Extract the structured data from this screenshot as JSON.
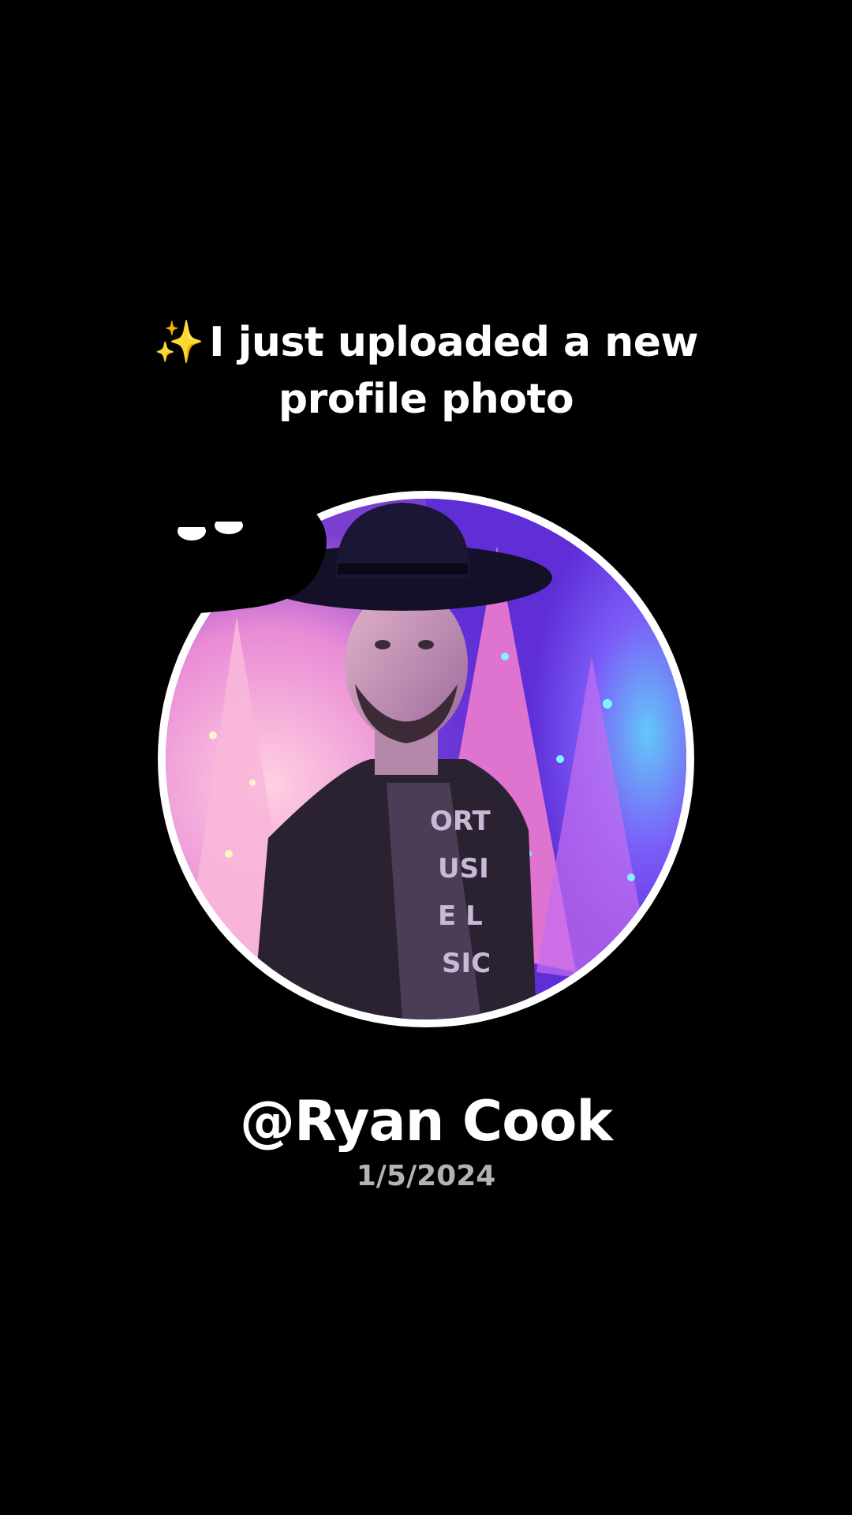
{
  "headline": {
    "sparkle": "✨",
    "line1": "I just uploaded a new",
    "line2": "profile photo"
  },
  "profile": {
    "username": "@Ryan Cook",
    "date": "1/5/2024",
    "photo_description_icon": "profile-photo"
  },
  "colors": {
    "background": "#000000",
    "text": "#ffffff",
    "date_text": "#b3b3b3",
    "ring": "#ffffff",
    "sparkle": "#f7d44c"
  }
}
